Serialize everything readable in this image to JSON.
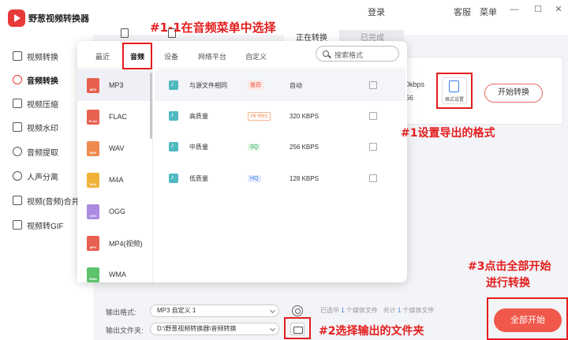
{
  "app": {
    "title": "野葱视频转换器",
    "login": "登录",
    "service": "客服",
    "menu": "菜单",
    "minimize": "—",
    "maximize": "☐",
    "close": "✕"
  },
  "sidebar": {
    "items": [
      {
        "label": "视频转换"
      },
      {
        "label": "音频转换"
      },
      {
        "label": "视频压缩"
      },
      {
        "label": "视频水印"
      },
      {
        "label": "音频提取"
      },
      {
        "label": "人声分离"
      },
      {
        "label": "视频(音频)合并"
      },
      {
        "label": "视频转GIF"
      }
    ]
  },
  "main": {
    "tabs": [
      "正在转换",
      "已完成"
    ],
    "file_card": {
      "bitrate": "0kbps",
      "extra": "56",
      "format_settings_label": "格式设置",
      "convert_button": "开始转换"
    }
  },
  "popup": {
    "tabs": [
      "最近",
      "音频",
      "设备",
      "网络平台",
      "自定义"
    ],
    "search_placeholder": "搜索格式",
    "formats": [
      "MP3",
      "FLAC",
      "WAV",
      "M4A",
      "OGG",
      "MP4(视频)",
      "WMA"
    ],
    "qualities": [
      {
        "name": "与源文件相同",
        "badge": "推荐",
        "rate": "自动"
      },
      {
        "name": "高质量",
        "badge": "Hi-Res",
        "rate": "320 KBPS"
      },
      {
        "name": "中质量",
        "badge": "SQ",
        "rate": "256 KBPS"
      },
      {
        "name": "低质量",
        "badge": "HQ",
        "rate": "128 KBPS"
      }
    ]
  },
  "bottom": {
    "output_format_label": "输出格式:",
    "output_format_value": "MP3 自定义 1",
    "output_folder_label": "输出文件夹:",
    "output_folder_value": "D:\\野葱视频转换器\\音频转换",
    "selected_prefix": "已选中",
    "selected_count": "1",
    "selected_suffix": "个媒体文件",
    "total_prefix": "共计",
    "total_count": "1",
    "total_suffix": "个媒体文件",
    "start_all": "全部开始"
  },
  "annotations": {
    "a1": "#1-1在音频菜单中选择",
    "a2": "#1设置导出的格式",
    "a3": "#2选择输出的文件夹",
    "a4_line1": "#3点击全部开始",
    "a4_line2": "进行转换"
  },
  "colors": {
    "accent": "#e93a3a",
    "annotation": "#e41d1d",
    "start": "#f0584c",
    "blue": "#3d7af0"
  }
}
